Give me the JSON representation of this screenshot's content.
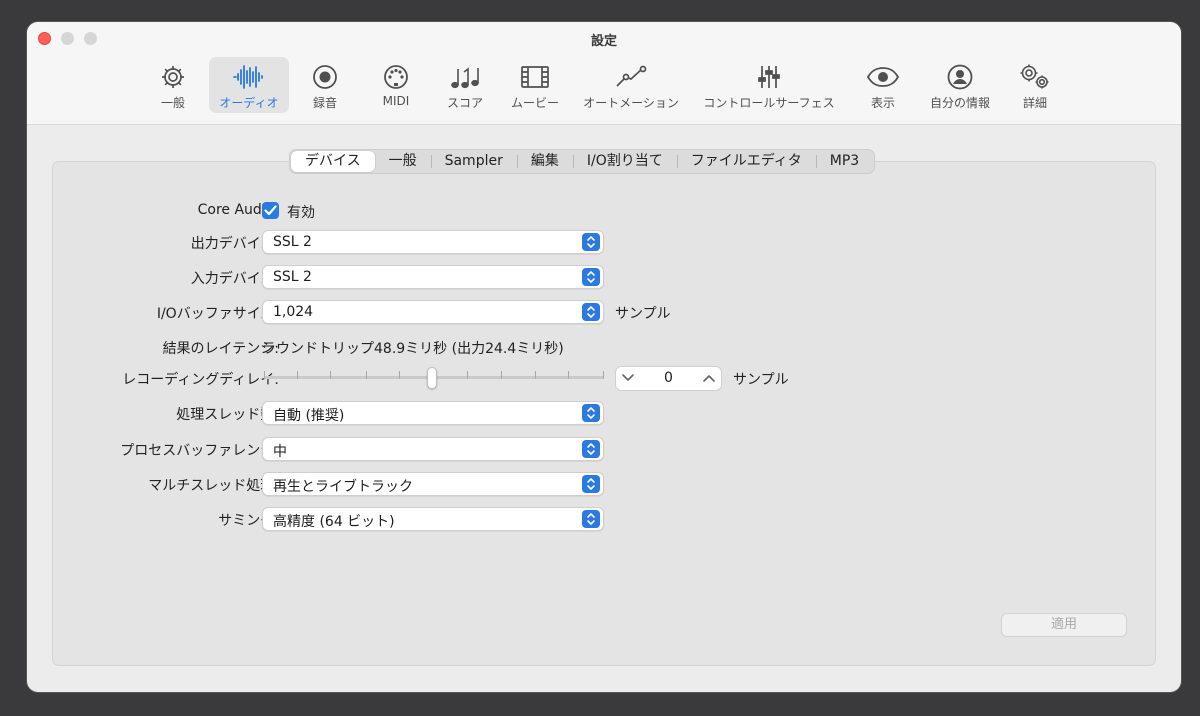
{
  "window": {
    "title": "設定"
  },
  "toolbar": {
    "items": [
      {
        "label": "一般",
        "icon": "gear-icon"
      },
      {
        "label": "オーディオ",
        "icon": "waveform-icon",
        "active": true
      },
      {
        "label": "録音",
        "icon": "record-icon"
      },
      {
        "label": "MIDI",
        "icon": "midi-port-icon"
      },
      {
        "label": "スコア",
        "icon": "music-notes-icon"
      },
      {
        "label": "ムービー",
        "icon": "film-icon"
      },
      {
        "label": "オートメーション",
        "icon": "automation-icon"
      },
      {
        "label": "コントロールサーフェス",
        "icon": "sliders-icon"
      },
      {
        "label": "表示",
        "icon": "eye-icon"
      },
      {
        "label": "自分の情報",
        "icon": "person-icon"
      },
      {
        "label": "詳細",
        "icon": "gears-icon"
      }
    ]
  },
  "tabs": [
    "デバイス",
    "一般",
    "Sampler",
    "編集",
    "I/O割り当て",
    "ファイルエディタ",
    "MP3"
  ],
  "form": {
    "core_audio_label": "Core Audio:",
    "core_audio_check": "有効",
    "output_device_label": "出力デバイス:",
    "output_device_value": "SSL 2",
    "input_device_label": "入力デバイス:",
    "input_device_value": "SSL 2",
    "buffer_label": "I/Oバッファサイズ:",
    "buffer_value": "1,024",
    "buffer_unit": "サンプル",
    "latency_label": "結果のレイテンシ:",
    "latency_value": "ラウンドトリップ48.9ミリ秒 (出力24.4ミリ秒)",
    "rec_delay_label": "レコーディングディレイ:",
    "rec_delay_value": "0",
    "rec_delay_unit": "サンプル",
    "threads_label": "処理スレッド数:",
    "threads_value": "自動 (推奨)",
    "process_buffer_label": "プロセスバッファレンジ:",
    "process_buffer_value": "中",
    "multithread_label": "マルチスレッド処理:",
    "multithread_value": "再生とライブトラック",
    "summing_label": "サミング:",
    "summing_value": "高精度 (64 ビット)"
  },
  "apply_label": "適用",
  "colors": {
    "accent": "#2a7ae2"
  }
}
